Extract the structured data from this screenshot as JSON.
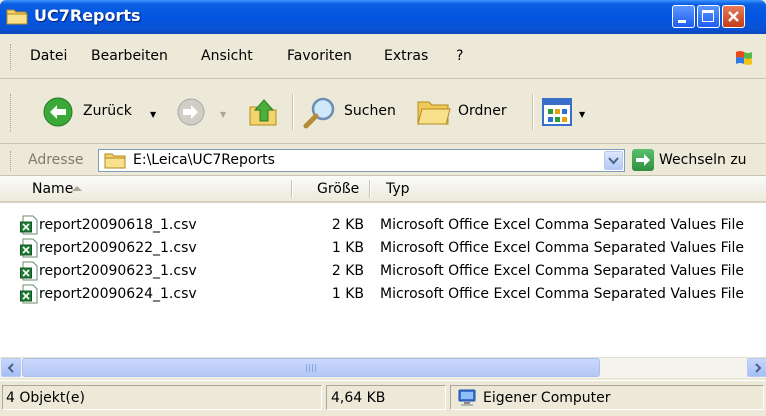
{
  "window": {
    "title": "UC7Reports"
  },
  "menubar": {
    "items": [
      "Datei",
      "Bearbeiten",
      "Ansicht",
      "Favoriten",
      "Extras",
      "?"
    ]
  },
  "toolbar": {
    "back_label": "Zurück",
    "search_label": "Suchen",
    "folders_label": "Ordner"
  },
  "address": {
    "label": "Adresse",
    "value": "E:\\Leica\\UC7Reports",
    "go_label": "Wechseln zu"
  },
  "list": {
    "columns": {
      "name": "Name",
      "size": "Größe",
      "type": "Typ"
    },
    "files": [
      {
        "name": "report20090618_1.csv",
        "size": "2 KB",
        "type": "Microsoft Office Excel Comma Separated Values File"
      },
      {
        "name": "report20090622_1.csv",
        "size": "1 KB",
        "type": "Microsoft Office Excel Comma Separated Values File"
      },
      {
        "name": "report20090623_1.csv",
        "size": "2 KB",
        "type": "Microsoft Office Excel Comma Separated Values File"
      },
      {
        "name": "report20090624_1.csv",
        "size": "1 KB",
        "type": "Microsoft Office Excel Comma Separated Values File"
      }
    ]
  },
  "statusbar": {
    "objects": "4 Objekt(e)",
    "total_size": "4,64 KB",
    "location": "Eigener Computer"
  },
  "colors": {
    "titlebar_blue": "#0255e0",
    "window_face": "#ece9d8",
    "excel_green": "#1e7b34"
  },
  "icons": [
    "folder-icon",
    "minimize-icon",
    "maximize-icon",
    "close-icon",
    "windows-flag-icon",
    "back-arrow-icon",
    "forward-arrow-icon",
    "up-folder-icon",
    "search-icon",
    "folders-icon",
    "views-icon",
    "dropdown-icon",
    "go-arrow-icon",
    "csv-file-icon",
    "computer-icon"
  ]
}
